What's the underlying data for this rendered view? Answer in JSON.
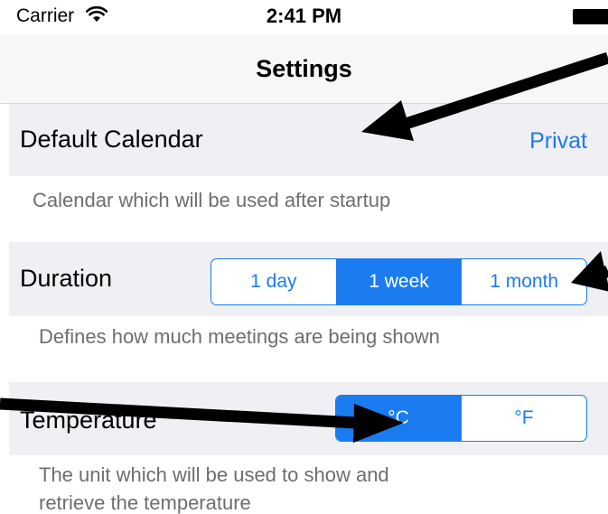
{
  "status_bar": {
    "carrier": "Carrier",
    "time": "2:41 PM",
    "wifi_icon": "wifi-icon",
    "battery_icon": "battery-icon"
  },
  "nav": {
    "title": "Settings"
  },
  "settings": {
    "default_calendar": {
      "label": "Default Calendar",
      "value": "Privat",
      "footer": "Calendar which will be used after startup"
    },
    "duration": {
      "label": "Duration",
      "options": [
        "1 day",
        "1 week",
        "1 month"
      ],
      "selected": "1 week",
      "footer": "Defines how much meetings are being shown"
    },
    "temperature": {
      "label": "Temperature",
      "options": [
        "°C",
        "°F"
      ],
      "selected": "°C",
      "footer": "The unit which will be used to show and retrieve the temperature"
    }
  },
  "colors": {
    "tint": "#1a7cf0",
    "group_background": "#efeff4",
    "footer_text": "#6d6d72",
    "annotation_arrow": "#000000"
  }
}
